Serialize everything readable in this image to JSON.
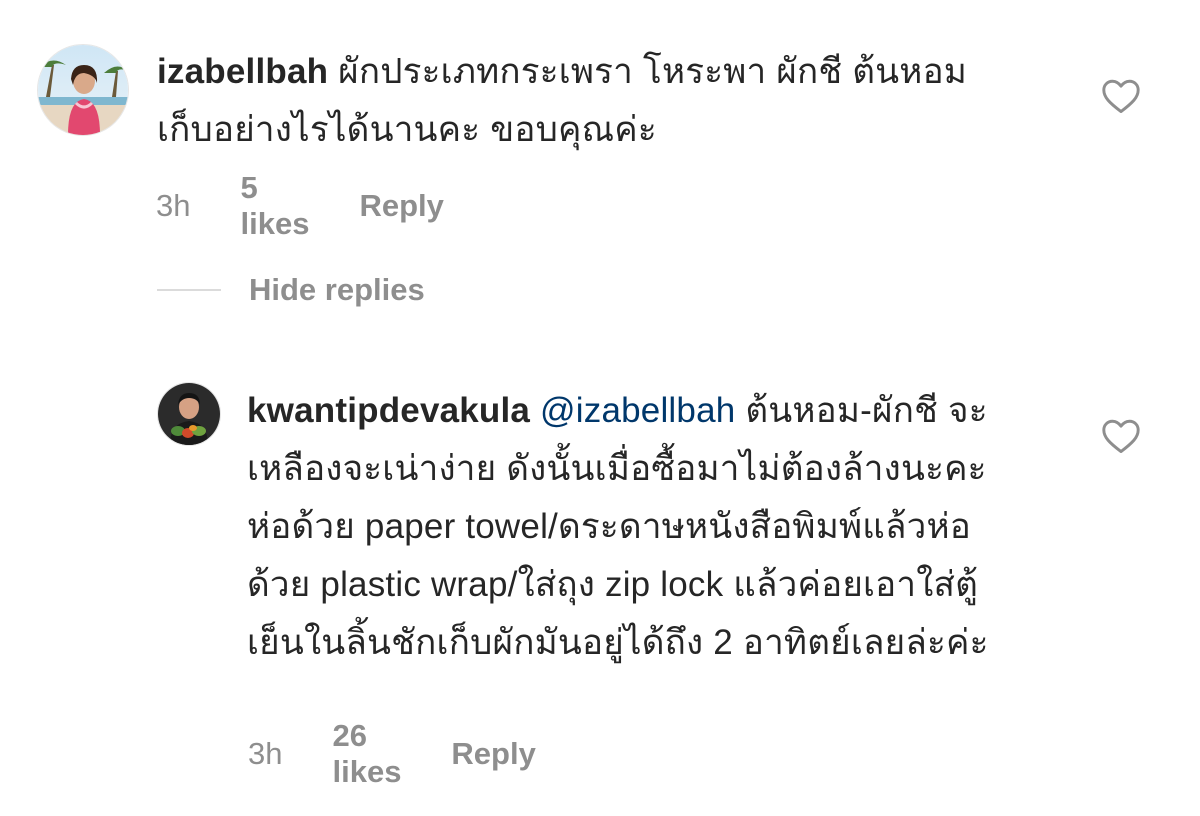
{
  "comments": [
    {
      "username": "izabellbah",
      "text": " ผักประเภทกระเพรา โหระพา ผักชี ต้นหอม เก็บอย่างไรได้นานคะ ขอบคุณค่ะ",
      "time": "3h",
      "likes": "5 likes",
      "reply_label": "Reply",
      "avatar_icon": "avatar-beach-photo",
      "like_icon": "heart-outline-icon"
    }
  ],
  "hide_replies_label": "Hide replies",
  "replies": [
    {
      "username": "kwantipdevakula",
      "mention": "@izabellbah",
      "text": " ต้นหอม-ผักชี จะเหลืองจะเน่าง่าย ดังนั้นเมื่อซื้อมาไม่ต้องล้างนะคะ ห่อด้วย paper towel/ดระดาษหนังสือพิมพ์แล้วห่อด้วย plastic wrap/ใส่ถุง zip lock แล้วค่อยเอาใส่ตู้เย็นในลิ้นชักเก็บผักมันอยู่ได้ถึง 2 อาทิตย์เลยล่ะค่ะ",
      "time": "3h",
      "likes": "26 likes",
      "reply_label": "Reply",
      "avatar_icon": "avatar-portrait-photo",
      "like_icon": "heart-outline-icon"
    }
  ],
  "colors": {
    "text": "#262626",
    "secondary": "#8e8e8e",
    "mention": "#00376b",
    "divider": "#dbdbdb"
  }
}
